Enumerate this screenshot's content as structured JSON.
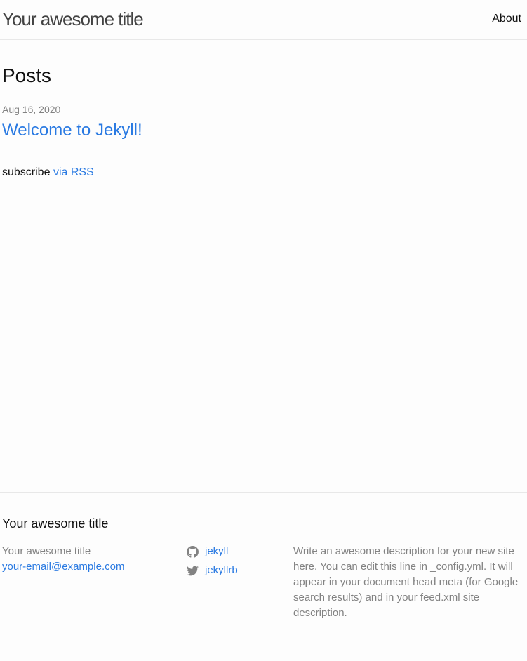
{
  "header": {
    "site_title": "Your awesome title",
    "nav": {
      "about": "About"
    }
  },
  "main": {
    "heading": "Posts",
    "posts": [
      {
        "date": "Aug 16, 2020",
        "title": "Welcome to Jekyll!"
      }
    ],
    "rss": {
      "prefix": "subscribe",
      "link": "via RSS"
    }
  },
  "footer": {
    "heading": "Your awesome title",
    "contact": {
      "name": "Your awesome title",
      "email": "your-email@example.com"
    },
    "social": [
      {
        "icon": "github-icon",
        "label": "jekyll"
      },
      {
        "icon": "twitter-icon",
        "label": "jekyllrb"
      }
    ],
    "description": "Write an awesome description for your new site here. You can edit this line in _config.yml. It will appear in your document head meta (for Google search results) and in your feed.xml site description."
  },
  "colors": {
    "link": "#2a7ae2",
    "text": "#111111",
    "muted": "#828282",
    "border": "#e8e8e8",
    "background": "#fdfdfd"
  }
}
